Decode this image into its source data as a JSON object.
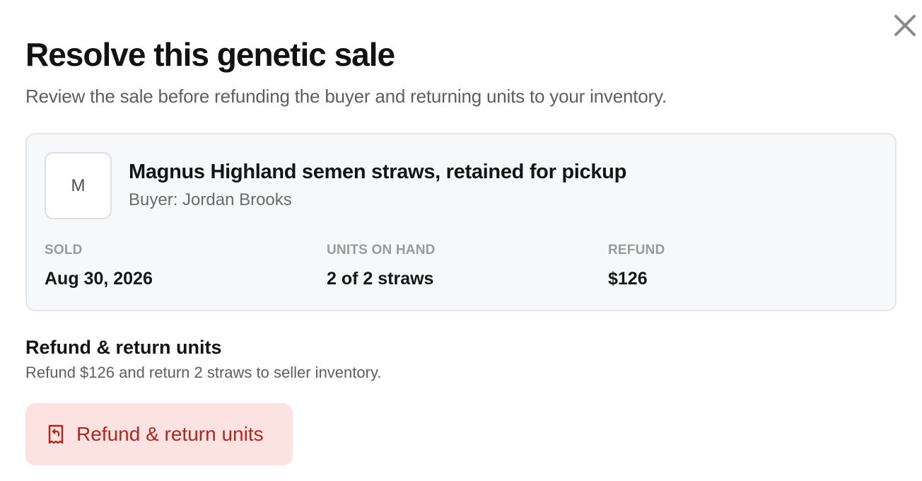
{
  "header": {
    "title": "Resolve this genetic sale",
    "subtitle": "Review the sale before refunding the buyer and returning units to your inventory.",
    "close_icon": "close-icon"
  },
  "sale_card": {
    "avatar_letter": "M",
    "item_title": "Magnus Highland semen straws, retained for pickup",
    "buyer": "Buyer: Jordan Brooks",
    "stats": [
      {
        "label": "SOLD",
        "value": "Aug 30, 2026"
      },
      {
        "label": "UNITS ON HAND",
        "value": "2 of 2 straws"
      },
      {
        "label": "REFUND",
        "value": "$126"
      }
    ]
  },
  "action_section": {
    "title": "Refund & return units",
    "description": "Refund $126 and return 2 straws to seller inventory.",
    "button_label": "Refund & return units",
    "button_icon": "receipt-refund-icon"
  },
  "colors": {
    "danger_text": "#b3261e",
    "danger_bg": "#fde2e2",
    "card_bg": "#f7f8fa",
    "card_border": "#e3e5e8",
    "muted_text": "#5e5e5e"
  }
}
